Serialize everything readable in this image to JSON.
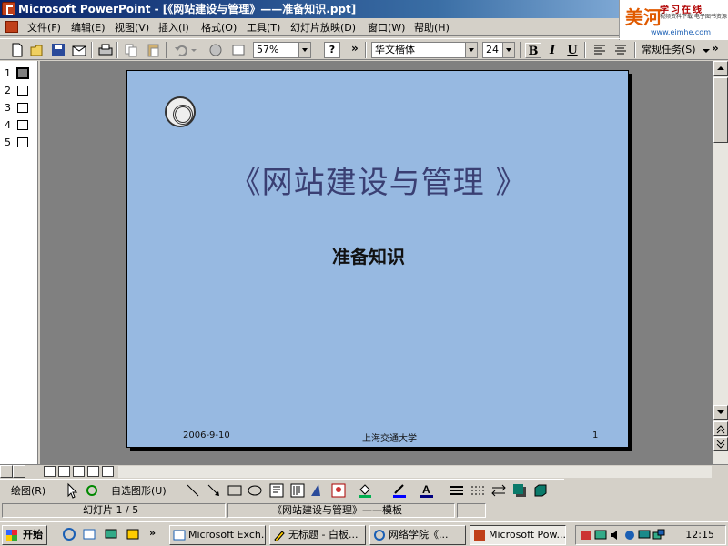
{
  "window": {
    "title": "Microsoft PowerPoint - [《网站建设与管理》——准备知识.ppt]"
  },
  "brand": {
    "logo": "美河",
    "tag": "学习在线",
    "tag2": "视频资料下载 电子图书资源",
    "url": "www.eimhe.com"
  },
  "menu": {
    "items": [
      "文件(F)",
      "编辑(E)",
      "视图(V)",
      "插入(I)",
      "格式(O)",
      "工具(T)",
      "幻灯片放映(D)",
      "窗口(W)",
      "帮助(H)"
    ]
  },
  "toolbar": {
    "zoom": "57%",
    "font": "华文楷体",
    "font_size": "24",
    "bold": "B",
    "italic": "I",
    "underline": "U",
    "tasks": "常规任务(S)",
    "more": "»"
  },
  "slides_pane": {
    "numbers": [
      "1",
      "2",
      "3",
      "4",
      "5"
    ],
    "selected_index": 0
  },
  "slide": {
    "title": "《网站建设与管理 》",
    "subtitle": "准备知识",
    "date": "2006-9-10",
    "org": "上海交通大学",
    "page": "1"
  },
  "drawing": {
    "draw_label": "绘图(R)",
    "autoshapes_label": "自选图形(U)"
  },
  "status": {
    "slide_info": "幻灯片 1 / 5",
    "template": "《网站建设与管理》——模板"
  },
  "taskbar": {
    "start": "开始",
    "tasks": [
      {
        "label": "Microsoft Exch...",
        "active": false
      },
      {
        "label": "无标题 - 白板...",
        "active": false
      },
      {
        "label": "网络学院《...",
        "active": false
      },
      {
        "label": "Microsoft Pow...",
        "active": true
      }
    ],
    "clock": "12:15"
  },
  "colors": {
    "slide_bg": "#97b9e1",
    "title_color": "#3a3f73",
    "titlebar": "#0a246a"
  }
}
